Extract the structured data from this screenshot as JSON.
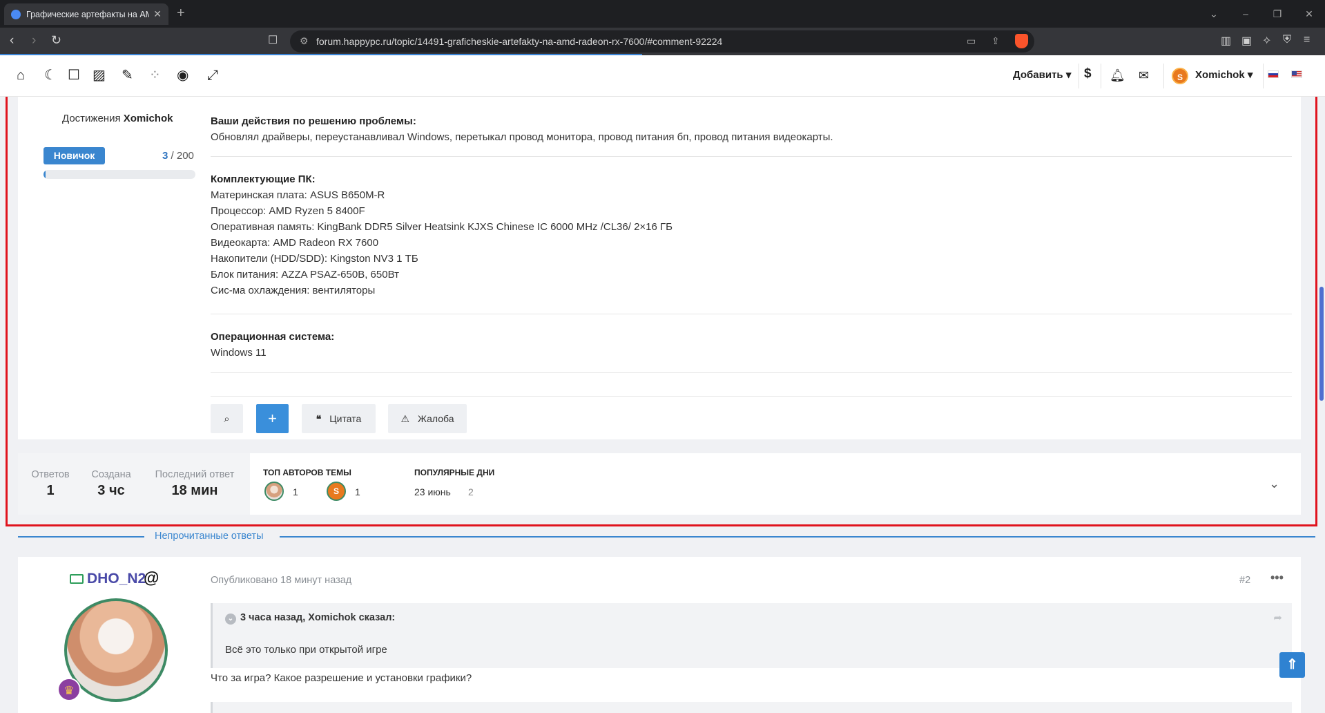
{
  "browser": {
    "tab_title": "Графические артефакты на AMD",
    "tab_close": "✕",
    "new_tab": "+",
    "url": "forum.happypc.ru/topic/14491-graficheskie-artefakty-na-amd-radeon-rx-7600/#comment-92224"
  },
  "header": {
    "add_label": "Добавить",
    "dollar": "$",
    "user_initial": "S",
    "username": "Xomichok"
  },
  "achievements": {
    "title_prefix": "Достижения",
    "user": "Xomichok",
    "rank": "Новичок",
    "points": "3",
    "points_total": "/ 200",
    "progress_fraction": 0.015
  },
  "post": {
    "actions_heading": "Ваши действия по решению проблемы:",
    "actions_text": "Обновлял драйверы, переустанавливал Windows, перетыкал провод монитора, провод питания бп, провод питания видеокарты.",
    "components_heading": "Комплектующие ПК:",
    "components": [
      "Материнская плата: ASUS B650M-R",
      "Процессор: AMD Ryzen 5 8400F",
      "Оперативная память: KingBank DDR5 Silver Heatsink KJXS Chinese IC 6000 MHz /CL36/ 2×16 ГБ",
      "Видеокарта: AMD Radeon RX 7600",
      "Накопители (HDD/SDD): Kingston NV3 1 ТБ",
      "Блок питания: AZZA PSAZ-650B, 650Вт",
      "Сис-ма охлаждения: вентиляторы"
    ],
    "os_heading": "Операционная система:",
    "os_value": "Windows 11",
    "btn_plus": "+",
    "btn_quote": "Цитата",
    "btn_report": "Жалоба"
  },
  "stats": {
    "replies_label": "Ответов",
    "replies_value": "1",
    "created_label": "Создана",
    "created_value": "3 чс",
    "last_reply_label": "Последний ответ",
    "last_reply_value": "18 мин",
    "top_authors_label": "ТОП АВТОРОВ ТЕМЫ",
    "top_authors": [
      {
        "count": "1"
      },
      {
        "initial": "S",
        "count": "1"
      }
    ],
    "popular_days_label": "ПОПУЛЯРНЫЕ ДНИ",
    "popular_day": "23 июнь",
    "popular_day_count": "2"
  },
  "unread_label": "Непрочитанные ответы",
  "reply_post": {
    "author": "DHO_N2",
    "at_sign": "@",
    "published": "Опубликовано 18 минут назад",
    "post_number": "#2",
    "quote_cite": "3 часа назад, Xomichok сказал:",
    "quote_text": "Всё это только при открытой игре",
    "reply_text": "Что за игра? Какое разрешение и установки графики?"
  },
  "colors": {
    "accent": "#3a86cf",
    "highlight_frame": "#e0131d",
    "author_name": "#4a4aa8"
  }
}
